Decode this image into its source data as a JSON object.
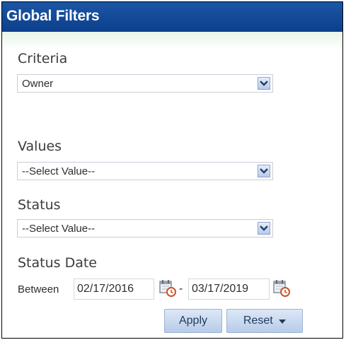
{
  "header": {
    "title": "Global Filters"
  },
  "criteria": {
    "label": "Criteria",
    "selected": "Owner"
  },
  "values": {
    "label": "Values",
    "selected": "--Select Value--"
  },
  "status": {
    "label": "Status",
    "selected": "--Select Value--"
  },
  "status_date": {
    "label": "Status Date",
    "between_label": "Between",
    "start_date": "02/17/2016",
    "separator": "-",
    "end_date": "03/17/2019"
  },
  "buttons": {
    "apply": "Apply",
    "reset": "Reset"
  },
  "colors": {
    "header_bg": "#1b56a5",
    "header_text": "#ffffff",
    "button_bg": "#c9d9ef",
    "label_text": "#3c3c3c"
  },
  "icons": {
    "dropdown": "chevron-down-icon",
    "calendar": "calendar-clock-icon",
    "reset_menu": "caret-down-icon"
  }
}
